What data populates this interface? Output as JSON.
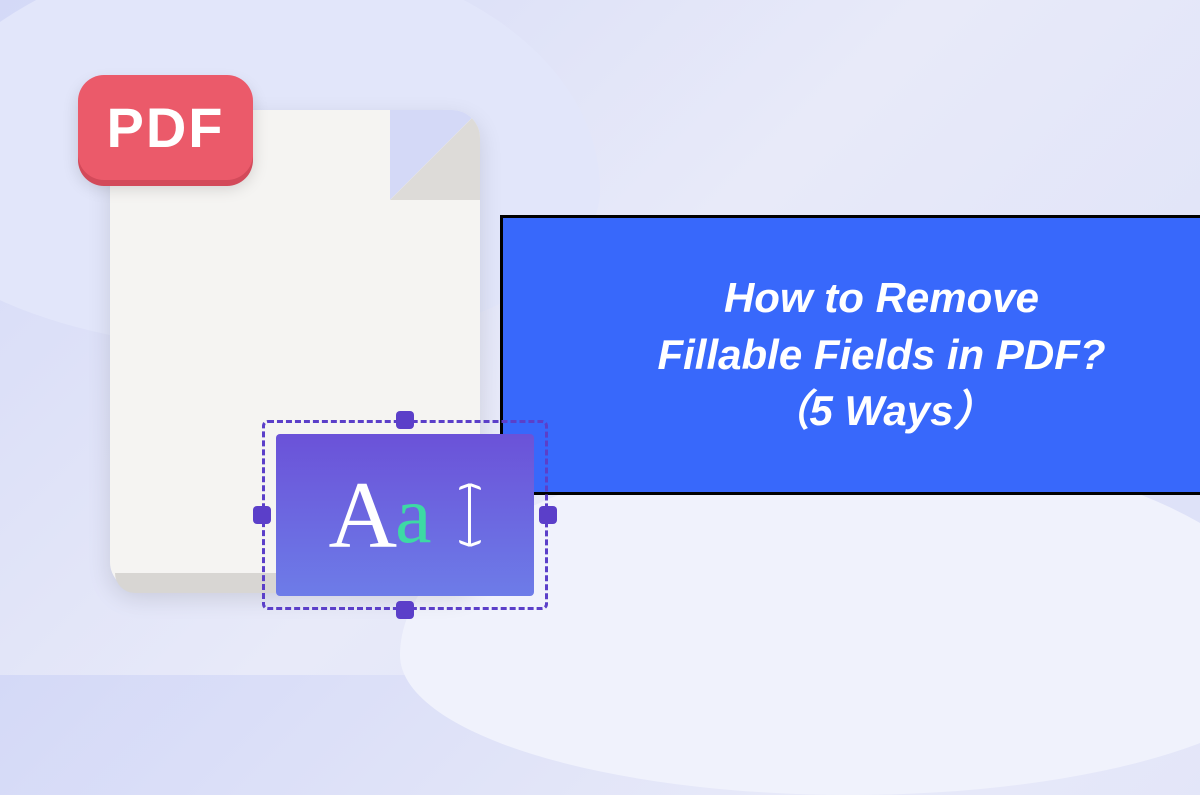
{
  "badge": {
    "label": "PDF"
  },
  "title": {
    "line1": "How to Remove",
    "line2": "Fillable Fields in PDF?",
    "line3": "（5 Ways）"
  },
  "text_field": {
    "glyph_upper": "A",
    "glyph_lower": "a"
  },
  "colors": {
    "banner": "#3868fb",
    "badge": "#eb5a6a",
    "handle": "#5b3fc9",
    "glyph_accent": "#3dd9a4"
  }
}
